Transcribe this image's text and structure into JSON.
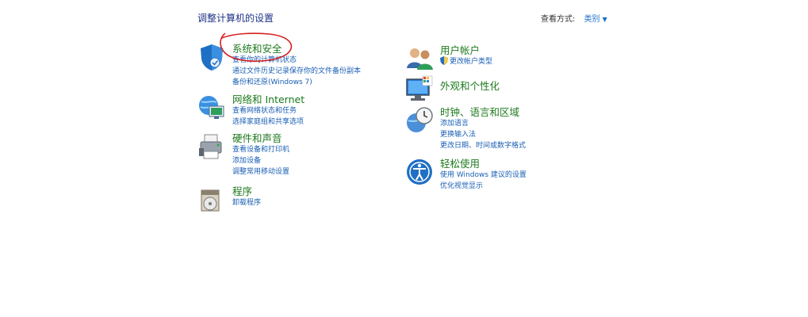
{
  "page": {
    "title": "调整计算机的设置",
    "view_by_label": "查看方式:",
    "view_by_value": "类别"
  },
  "left": [
    {
      "icon": "security-shield-icon",
      "title": "系统和安全",
      "links": [
        "查看你的计算机状态",
        "通过文件历史记录保存你的文件备份副本",
        "备份和还原(Windows 7)"
      ]
    },
    {
      "icon": "network-globe-icon",
      "title": "网络和 Internet",
      "links": [
        "查看网络状态和任务",
        "选择家庭组和共享选项"
      ]
    },
    {
      "icon": "printer-icon",
      "title": "硬件和声音",
      "links": [
        "查看设备和打印机",
        "添加设备",
        "调整常用移动设置"
      ]
    },
    {
      "icon": "programs-disc-icon",
      "title": "程序",
      "links": [
        "卸载程序"
      ]
    }
  ],
  "right": [
    {
      "icon": "users-icon",
      "title": "用户帐户",
      "links": [
        "更改帐户类型"
      ]
    },
    {
      "icon": "monitor-palette-icon",
      "title": "外观和个性化",
      "links": []
    },
    {
      "icon": "clock-globe-icon",
      "title": "时钟、语言和区域",
      "links": [
        "添加语言",
        "更换输入法",
        "更改日期、时间或数字格式"
      ]
    },
    {
      "icon": "ease-of-access-icon",
      "title": "轻松使用",
      "links": [
        "使用 Windows 建议的设置",
        "优化视觉显示"
      ]
    }
  ],
  "colors": {
    "title": "#1e7a1e",
    "link": "#1a5fb4",
    "heading": "#1e3287",
    "annotation": "#d62020"
  }
}
